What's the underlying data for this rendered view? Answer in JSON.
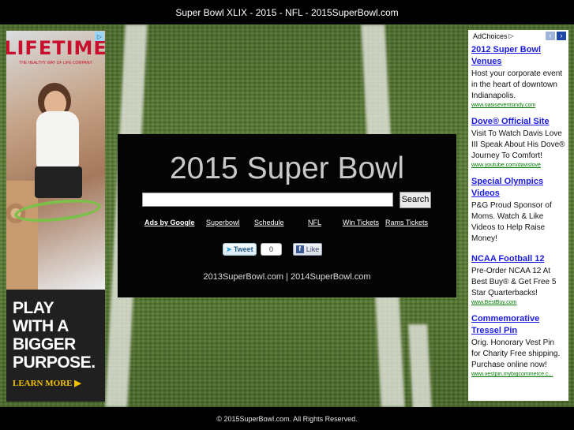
{
  "header": {
    "title": "Super Bowl XLIX - 2015 - NFL - 2015SuperBowl.com"
  },
  "left_ad": {
    "brand": "LIFETIME",
    "tagline": "THE HEALTHY WAY OF LIFE COMPANY",
    "promo_lines": [
      "PLAY",
      "WITH A",
      "BIGGER",
      "PURPOSE."
    ],
    "cta": "LEARN MORE ▶",
    "icon": "adchoices-icon",
    "colors": {
      "brand": "#c8102e",
      "accent": "#f5c400"
    }
  },
  "main": {
    "heading": "2015 Super Bowl",
    "search": {
      "value": "",
      "placeholder": "",
      "button_label": "Search"
    },
    "links": {
      "ads_by_google": "Ads by Google",
      "items": [
        "Superbowl",
        "Schedule",
        "NFL",
        "Win Tickets",
        "Rams Tickets"
      ]
    },
    "social": {
      "tweet_label": "Tweet",
      "tweet_count": "0",
      "like_label": "Like"
    },
    "site_links": "2013SuperBowl.com | 2014SuperBowl.com"
  },
  "right_ad": {
    "adchoices_label": "AdChoices",
    "ads": [
      {
        "title": "2012 Super Bowl Venues",
        "desc": "Host your corporate event in the heart of downtown Indianapolis.",
        "url": "www.oasiseventsindy.com"
      },
      {
        "title": "Dove® Official Site",
        "desc": "Visit To Watch Davis Love III Speak About His Dove® Journey To Comfort!",
        "url": "www.youtube.com/davislove"
      },
      {
        "title": "Special Olympics Videos",
        "desc": "P&G Proud Sponsor of Moms. Watch & Like Videos to Help Raise Money!",
        "url": ""
      },
      {
        "title": "NCAA Football 12",
        "desc": "Pre-Order NCAA 12 At Best Buy® & Get Free 5 Star Quarterbacks!",
        "url": "www.BestBuy.com"
      },
      {
        "title": "Commemorative Tressel Pin",
        "desc": "Orig. Honorary Vest Pin for Charity Free shipping. Purchase online now!",
        "url": "www.vestpin.mybigcommerce.c..."
      }
    ]
  },
  "footer": {
    "copyright": "© 2015SuperBowl.com. All Rights Reserved."
  }
}
